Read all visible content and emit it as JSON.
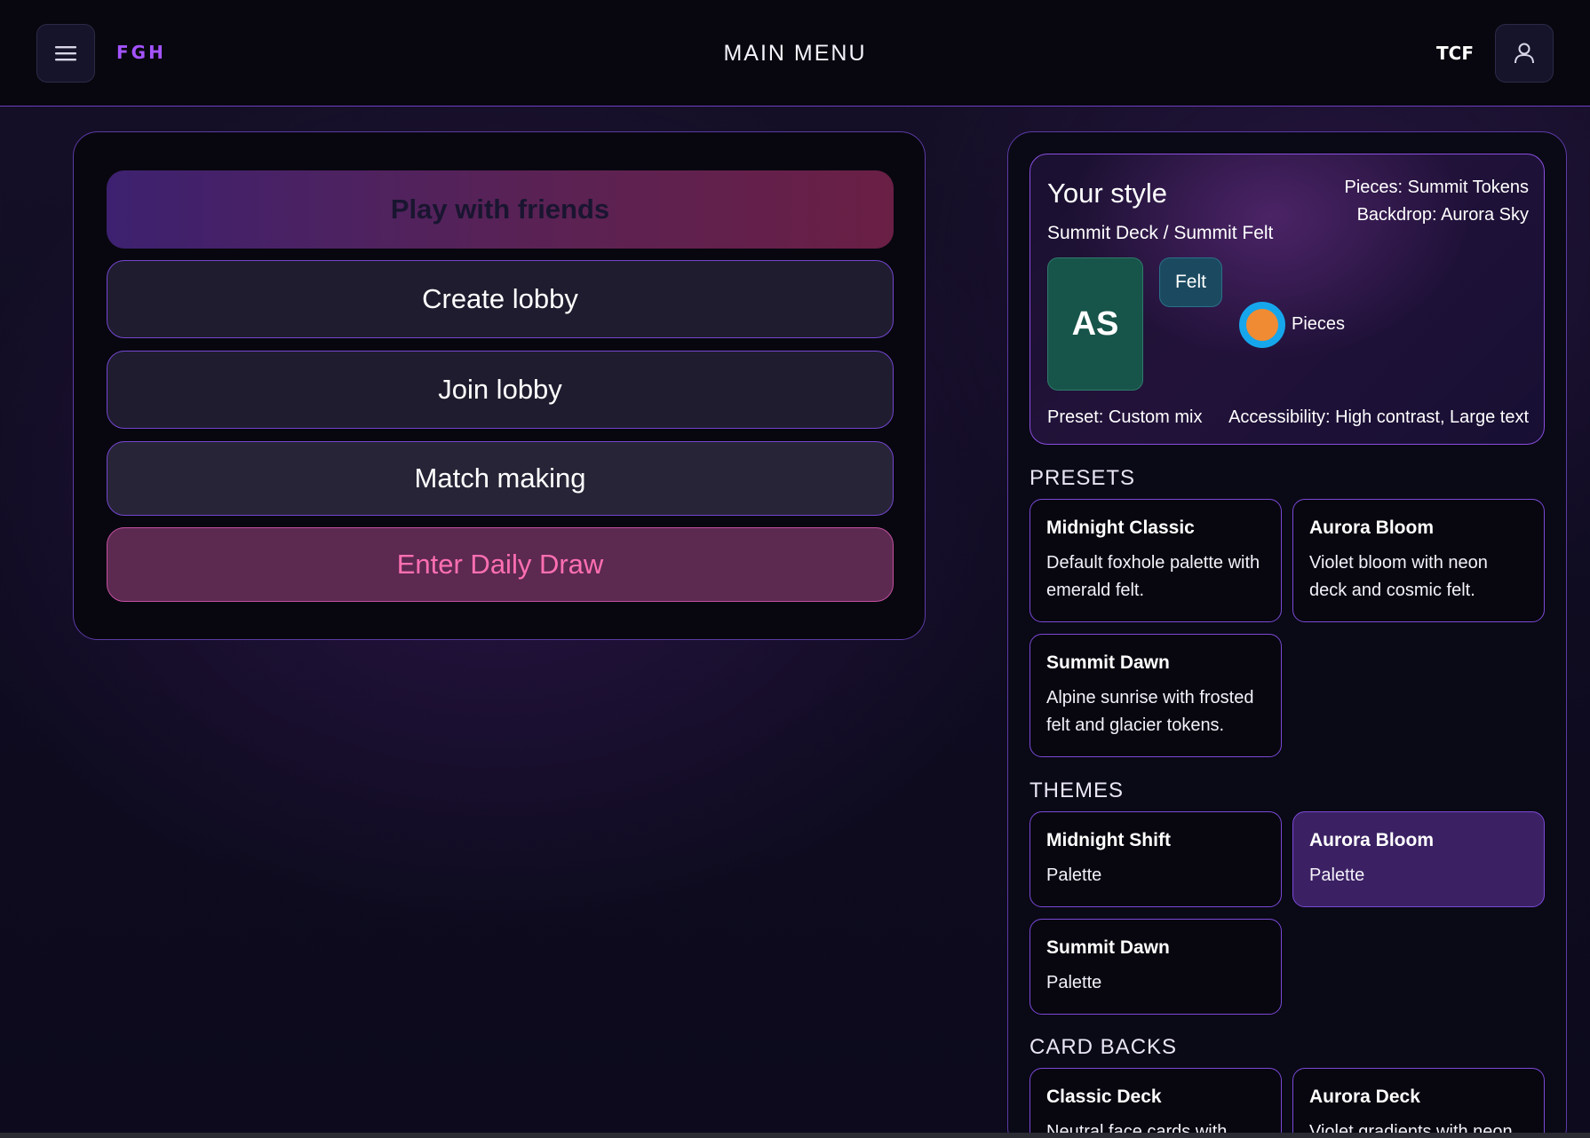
{
  "header": {
    "brand": "FGH",
    "title": "MAIN MENU",
    "user_tag": "TCF",
    "menu_icon": "hamburger-icon",
    "profile_icon": "user-icon"
  },
  "main_menu": {
    "play_with_friends": "Play with friends",
    "create_lobby": "Create lobby",
    "join_lobby": "Join lobby",
    "match_making": "Match making",
    "daily_draw": "Enter Daily Draw"
  },
  "style": {
    "title": "Your style",
    "subtitle": "Summit Deck / Summit Felt",
    "pieces": "Pieces: Summit Tokens",
    "backdrop": "Backdrop: Aurora Sky",
    "card_label": "AS",
    "felt_label": "Felt",
    "pieces_label": "Pieces",
    "preset": "Preset: Custom mix",
    "accessibility": "Accessibility: High contrast, Large text"
  },
  "presets": {
    "heading": "PRESETS",
    "items": [
      {
        "title": "Midnight Classic",
        "desc": "Default foxhole palette with emerald felt."
      },
      {
        "title": "Aurora Bloom",
        "desc": "Violet bloom with neon deck and cosmic felt."
      },
      {
        "title": "Summit Dawn",
        "desc": "Alpine sunrise with frosted felt and glacier tokens."
      }
    ]
  },
  "themes": {
    "heading": "THEMES",
    "items": [
      {
        "title": "Midnight Shift",
        "desc": "Palette"
      },
      {
        "title": "Aurora Bloom",
        "desc": "Palette",
        "selected": true
      },
      {
        "title": "Summit Dawn",
        "desc": "Palette"
      }
    ]
  },
  "card_backs": {
    "heading": "CARD BACKS",
    "items": [
      {
        "title": "Classic Deck",
        "desc": "Neutral face cards with"
      },
      {
        "title": "Aurora Deck",
        "desc": "Violet gradients with neon"
      }
    ]
  },
  "colors": {
    "accent": "#a353ff",
    "border": "#7446d0",
    "daily_draw_text": "#ff6fb1",
    "card_sample": "#175449",
    "token_fill": "#f08b33",
    "token_ring": "#16a6ec"
  }
}
